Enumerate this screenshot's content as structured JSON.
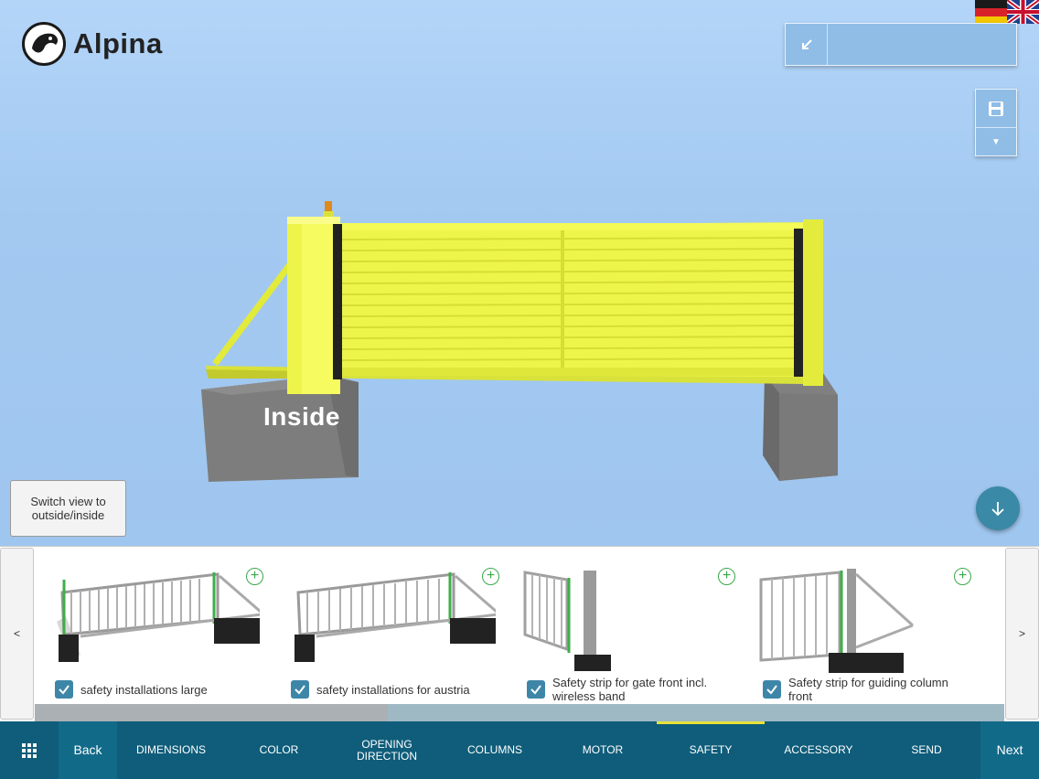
{
  "app": {
    "brand": "Alpina"
  },
  "colors": {
    "accent": "#0f5d7a",
    "check": "#3e86a8",
    "active_indicator": "#e7e23a",
    "gate": "#e8f23c"
  },
  "viewport": {
    "overlay_label": "Inside",
    "switch_view_label": "Switch view to outside/inside",
    "icons": [
      "collapse-arrow-icon",
      "save-icon",
      "caret-down-icon",
      "arrow-down-icon"
    ]
  },
  "carousel": {
    "prev_label": "<",
    "next_label": ">",
    "items": [
      {
        "label": "safety installations large",
        "checked": true
      },
      {
        "label": "safety installations for austria",
        "checked": true
      },
      {
        "label": "Safety strip for gate front incl. wireless band",
        "checked": true
      },
      {
        "label": "Safety strip for guiding column front",
        "checked": true
      }
    ]
  },
  "nav": {
    "back": "Back",
    "next": "Next",
    "steps": [
      {
        "label": "DIMENSIONS",
        "active": false
      },
      {
        "label": "COLOR",
        "active": false
      },
      {
        "label": "OPENING DIRECTION",
        "active": false
      },
      {
        "label": "COLUMNS",
        "active": false
      },
      {
        "label": "MOTOR",
        "active": false
      },
      {
        "label": "SAFETY",
        "active": true
      },
      {
        "label": "ACCESSORY",
        "active": false
      },
      {
        "label": "SEND",
        "active": false
      }
    ]
  }
}
